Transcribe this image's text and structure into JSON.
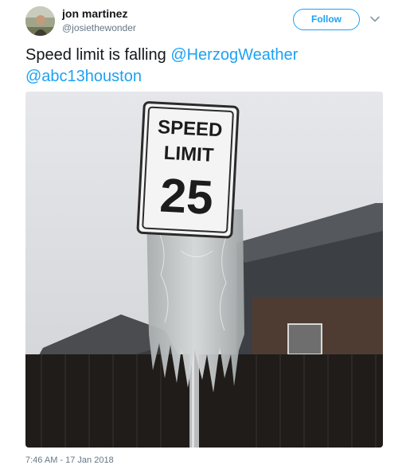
{
  "user": {
    "name": "jon martinez",
    "handle": "@josiethewonder"
  },
  "follow_label": "Follow",
  "tweet": {
    "text_prefix": "Speed limit is falling ",
    "mention_1": "@HerzogWeather",
    "mention_2": "@abc13houston"
  },
  "photo": {
    "sign_line_1": "SPEED",
    "sign_line_2": "LIMIT",
    "sign_number": "25"
  },
  "timestamp": "7:46 AM - 17 Jan 2018",
  "colors": {
    "accent": "#1da1f2",
    "text": "#14171a",
    "secondary_text": "#657786"
  }
}
